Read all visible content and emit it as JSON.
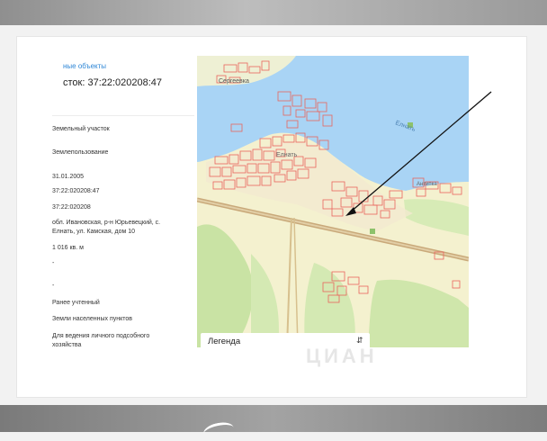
{
  "breadcrumb": "ные объекты",
  "cadastral_title": "сток: 37:22:020208:47",
  "rows": [
    {
      "value": "Земельный участок"
    },
    {
      "value": "Землепользование"
    },
    {
      "value": "31.01.2005"
    },
    {
      "value": "37:22:020208:47"
    },
    {
      "value": "37:22:020208"
    },
    {
      "value": "обл. Ивановская, р-н Юрьевецкий, с. Елнать, ул. Камская, дом 10"
    },
    {
      "value": "1 016 кв. м"
    },
    {
      "value": "-"
    },
    {
      "value": "-"
    },
    {
      "value": "Ранее учтенный"
    },
    {
      "value": "Земли населенных пунктов"
    },
    {
      "value": "Для ведения личного подсобного хозяйства"
    }
  ],
  "map": {
    "labels": {
      "village_top": "Сергеевка",
      "river": "Елнать",
      "village_main": "Елнать",
      "village_right": "Антипка"
    },
    "legend_label": "Легенда",
    "legend_chevron_icon": "chevron-up-down-icon",
    "watermark": "ЦИАН",
    "colors": {
      "water": "#a9d4f5",
      "land": "#f4f1cf",
      "forest": "#c9e3a4",
      "road": "#c9a97a",
      "parcel": "#e9655d",
      "arrow": "#111111"
    }
  }
}
